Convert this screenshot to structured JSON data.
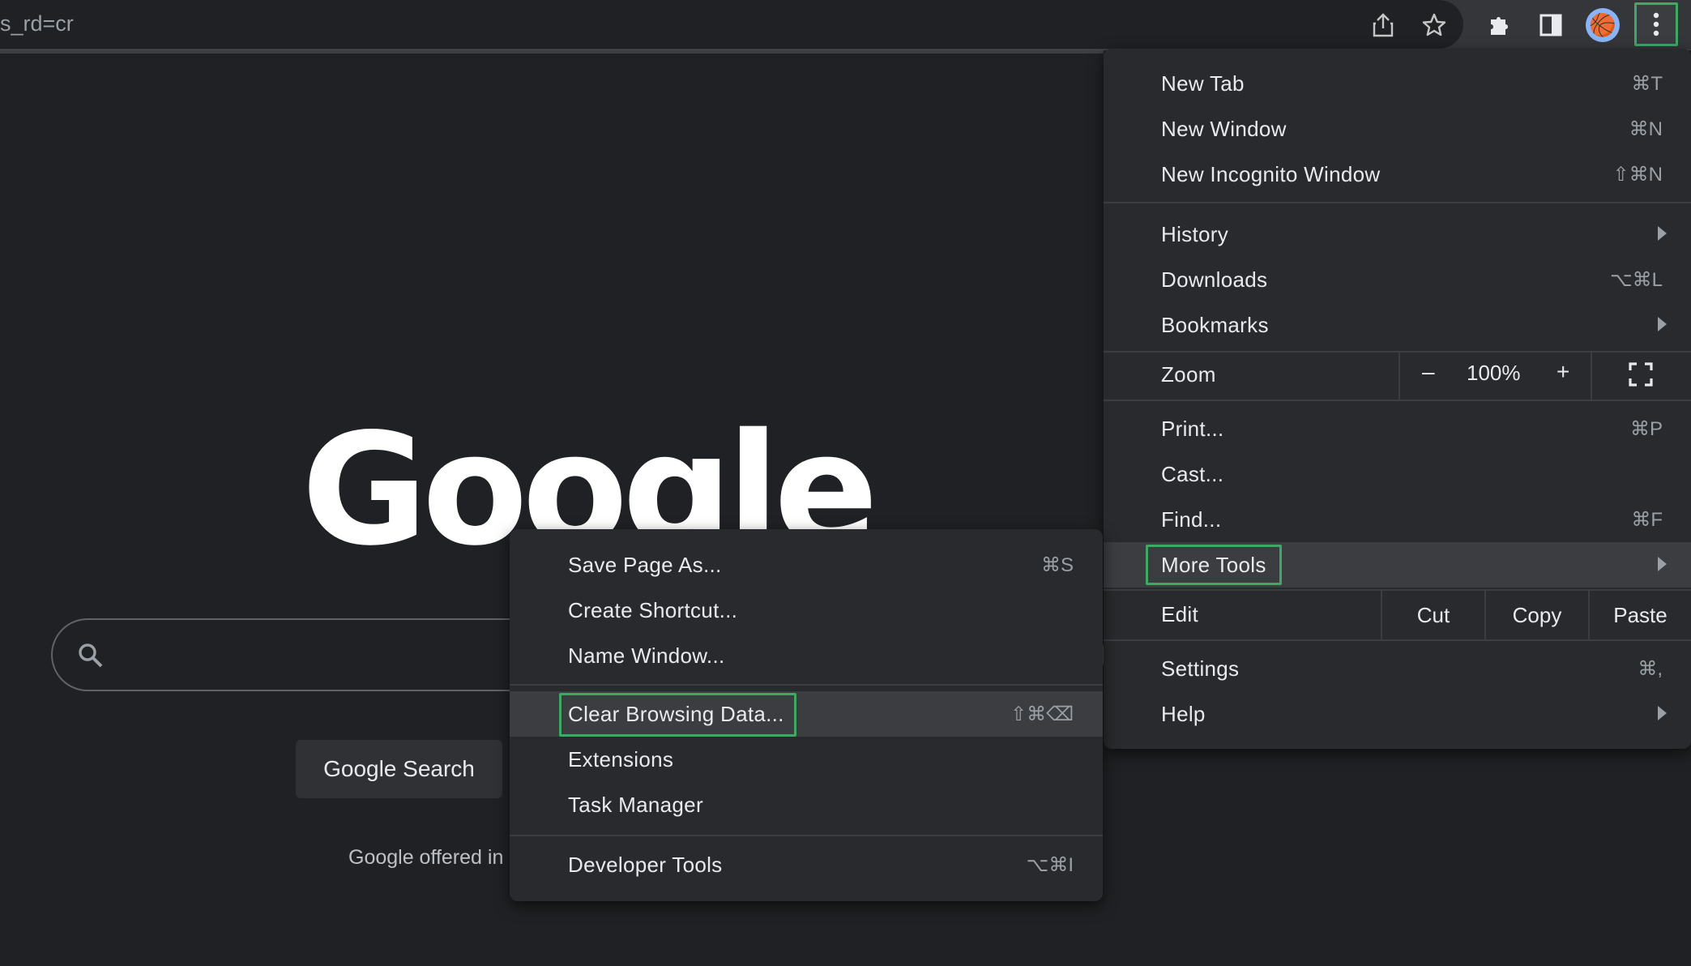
{
  "toolbar": {
    "url_fragment": "s_rd=cr",
    "icons": [
      "share-icon",
      "bookmark-star-icon",
      "extensions-icon",
      "side-panel-icon",
      "profile-avatar",
      "kebab-menu-icon"
    ],
    "avatar_glyph": "🏀"
  },
  "page": {
    "logo": "Google",
    "search_button": "Google Search",
    "offered_text": "Google offered in"
  },
  "main_menu": {
    "new_tab": {
      "label": "New Tab",
      "shortcut": "⌘T"
    },
    "new_window": {
      "label": "New Window",
      "shortcut": "⌘N"
    },
    "new_incognito": {
      "label": "New Incognito Window",
      "shortcut": "⇧⌘N"
    },
    "history": {
      "label": "History"
    },
    "downloads": {
      "label": "Downloads",
      "shortcut": "⌥⌘L"
    },
    "bookmarks": {
      "label": "Bookmarks"
    },
    "zoom": {
      "label": "Zoom",
      "minus": "–",
      "value": "100%",
      "plus": "+"
    },
    "print": {
      "label": "Print...",
      "shortcut": "⌘P"
    },
    "cast": {
      "label": "Cast..."
    },
    "find": {
      "label": "Find...",
      "shortcut": "⌘F"
    },
    "more_tools": {
      "label": "More Tools"
    },
    "edit": {
      "label": "Edit",
      "cut": "Cut",
      "copy": "Copy",
      "paste": "Paste"
    },
    "settings": {
      "label": "Settings",
      "shortcut": "⌘,"
    },
    "help": {
      "label": "Help"
    }
  },
  "sub_menu": {
    "save_page": {
      "label": "Save Page As...",
      "shortcut": "⌘S"
    },
    "create_shortcut": {
      "label": "Create Shortcut..."
    },
    "name_window": {
      "label": "Name Window..."
    },
    "clear_browsing": {
      "label": "Clear Browsing Data...",
      "shortcut": "⇧⌘⌫"
    },
    "extensions": {
      "label": "Extensions"
    },
    "task_manager": {
      "label": "Task Manager"
    },
    "dev_tools": {
      "label": "Developer Tools",
      "shortcut": "⌥⌘I"
    }
  },
  "colors": {
    "background": "#202124",
    "menu": "#292a2d",
    "highlight": "#3c3d41",
    "focus_outline": "#3fa865"
  }
}
